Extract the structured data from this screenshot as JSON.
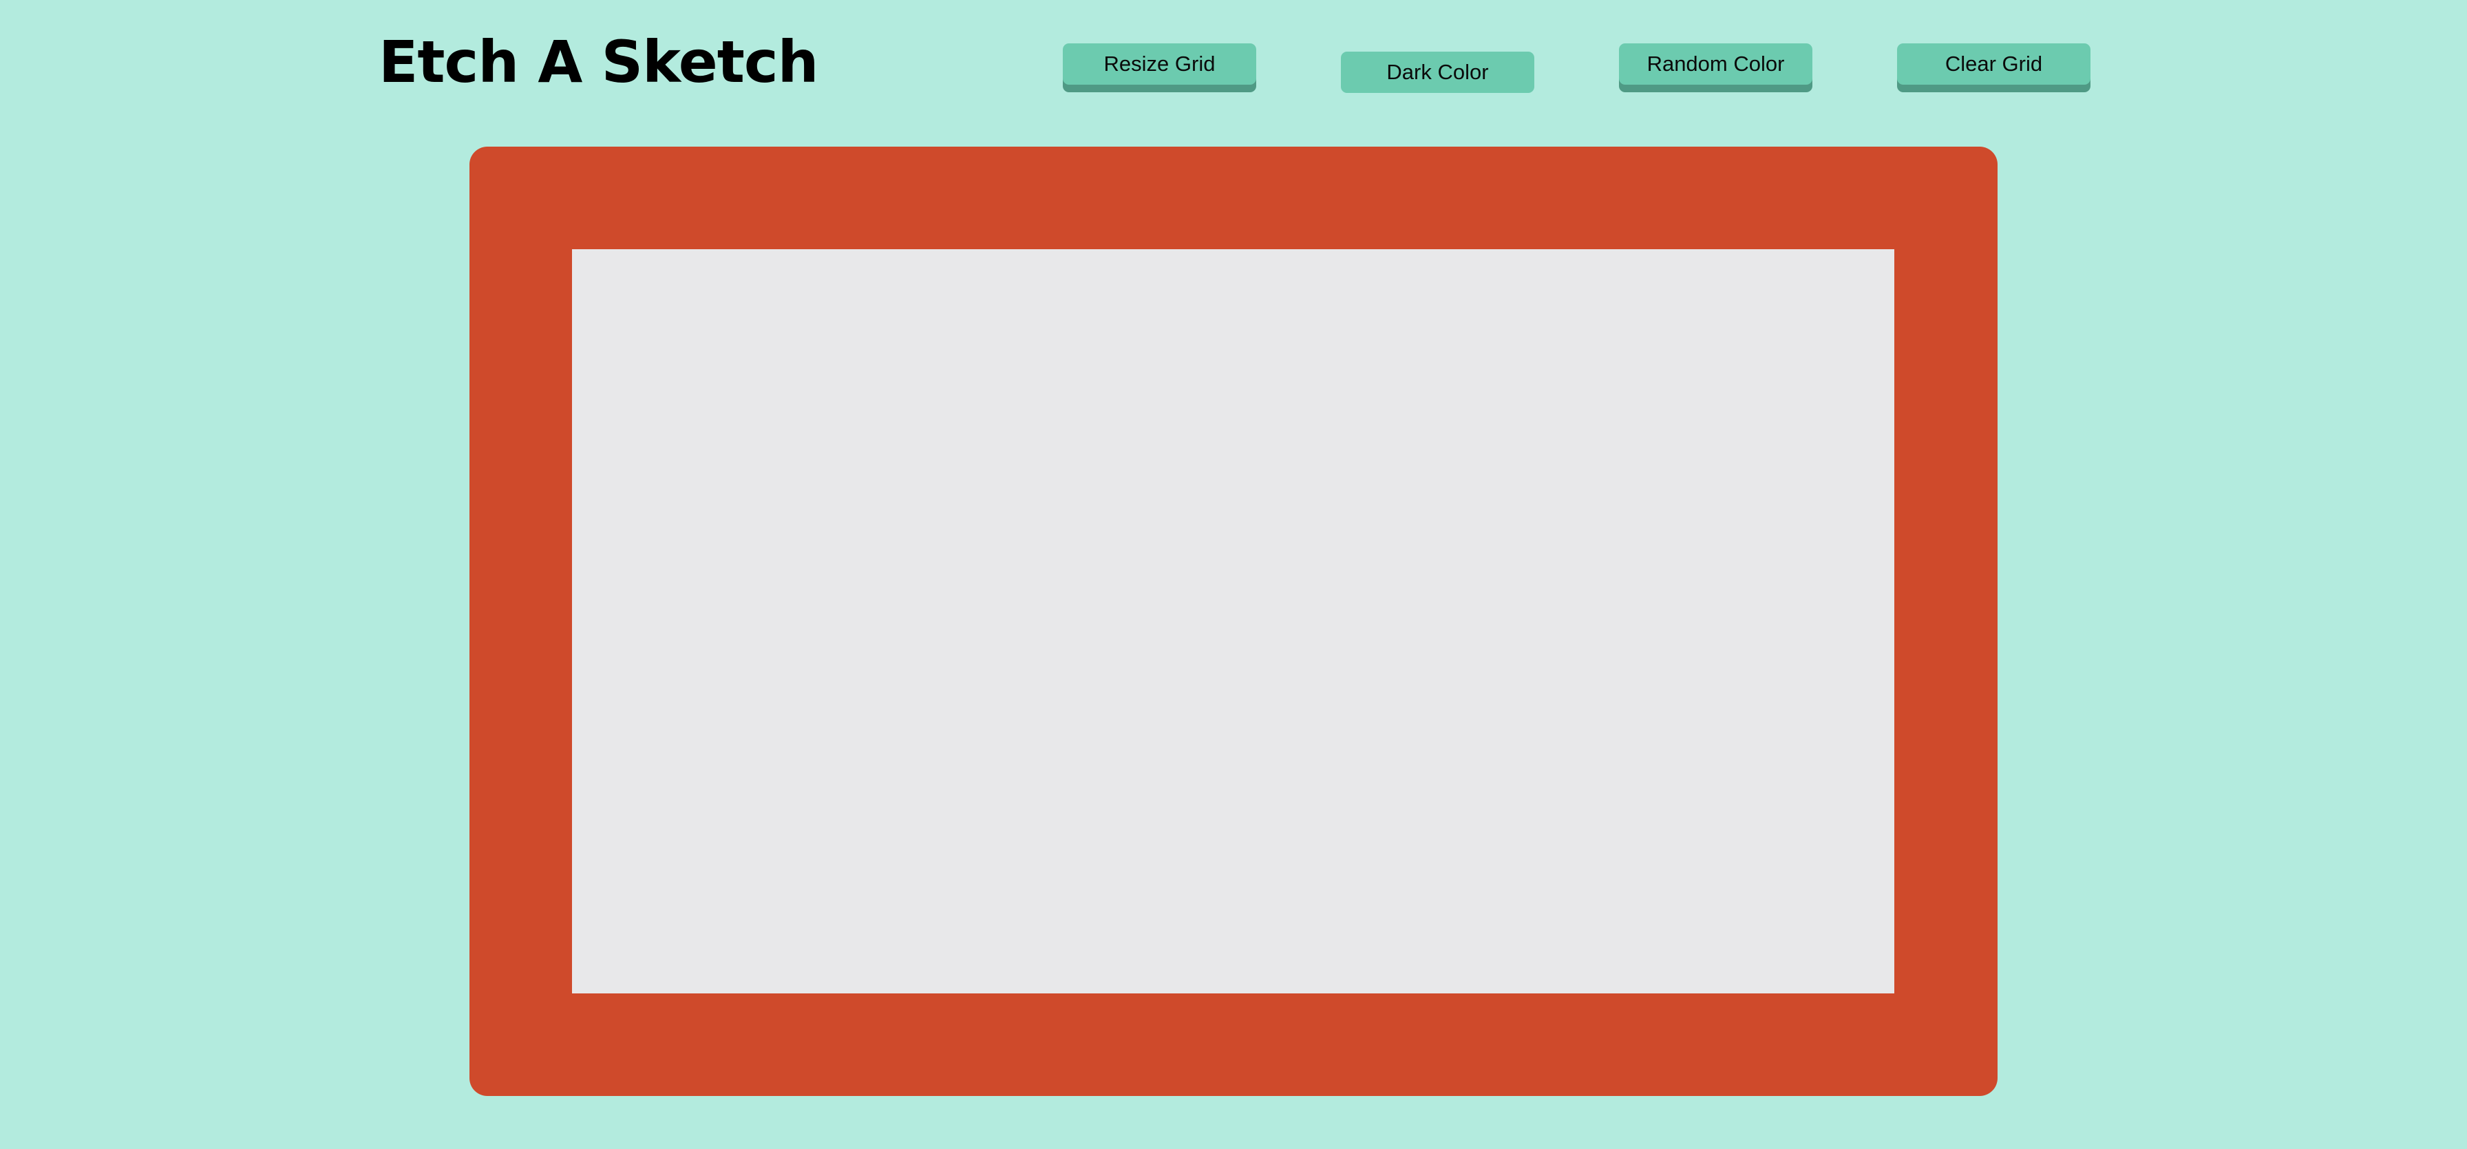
{
  "header": {
    "title": "Etch A Sketch"
  },
  "controls": {
    "resize_label": "Resize Grid",
    "dark_label": "Dark Color",
    "random_label": "Random Color",
    "clear_label": "Clear Grid"
  },
  "colors": {
    "background": "#b3ebde",
    "button": "#6ccbaf",
    "button_shadow": "#4f9a85",
    "frame": "#cf4a2b",
    "canvas": "#e8e8ea"
  }
}
